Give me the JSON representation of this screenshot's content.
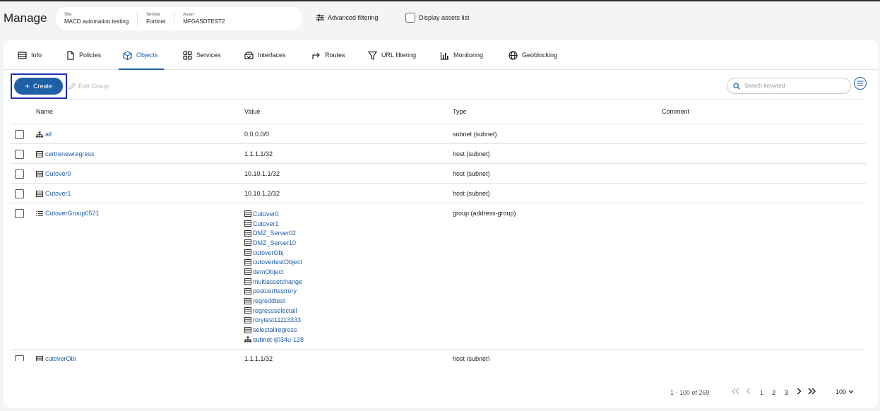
{
  "header": {
    "title": "Manage",
    "context": [
      {
        "label": "Site",
        "value": "MACD automation testing"
      },
      {
        "label": "Service",
        "value": "Fortinet"
      },
      {
        "label": "Asset",
        "value": "MFGASDTEST2"
      }
    ],
    "advanced_filtering": "Advanced filtering",
    "display_assets": "Display assets list"
  },
  "tabs": [
    {
      "label": "Info",
      "icon": "info-list-icon"
    },
    {
      "label": "Policies",
      "icon": "document-icon"
    },
    {
      "label": "Objects",
      "icon": "cube-icon",
      "active": true
    },
    {
      "label": "Services",
      "icon": "grid-icon"
    },
    {
      "label": "Interfaces",
      "icon": "interface-icon"
    },
    {
      "label": "Routes",
      "icon": "route-arrow-icon"
    },
    {
      "label": "URL filtering",
      "icon": "funnel-icon"
    },
    {
      "label": "Monitoring",
      "icon": "bar-chart-icon"
    },
    {
      "label": "Geoblocking",
      "icon": "globe-icon"
    }
  ],
  "toolbar": {
    "create_label": "Create",
    "edit_group_label": "Edit Group",
    "search_placeholder": "Search keyword"
  },
  "table": {
    "columns": [
      "Name",
      "Value",
      "Type",
      "Comment"
    ],
    "rows": [
      {
        "name": "all",
        "icon": "network-icon",
        "value": "0.0.0.0/0",
        "type": "subnet (subnet)",
        "comment": ""
      },
      {
        "name": "certrenewregress",
        "icon": "server-icon",
        "value": "1.1.1.1/32",
        "type": "host (subnet)",
        "comment": ""
      },
      {
        "name": "Cutover0",
        "icon": "server-icon",
        "value": "10.10.1.1/32",
        "type": "host (subnet)",
        "comment": ""
      },
      {
        "name": "Cutover1",
        "icon": "server-icon",
        "value": "10.10.1.2/32",
        "type": "host (subnet)",
        "comment": ""
      },
      {
        "name": "CutoverGroup0521",
        "icon": "list-icon",
        "type": "group (address-group)",
        "comment": "",
        "members": [
          {
            "name": "Cutover0",
            "icon": "server-icon"
          },
          {
            "name": "Cutover1",
            "icon": "server-icon"
          },
          {
            "name": "DMZ_Server02",
            "icon": "server-icon"
          },
          {
            "name": "DMZ_Server10",
            "icon": "server-icon"
          },
          {
            "name": "cutoverObj",
            "icon": "server-icon"
          },
          {
            "name": "cutovertestObject",
            "icon": "server-icon"
          },
          {
            "name": "demObject",
            "icon": "server-icon"
          },
          {
            "name": "multiassetchange",
            "icon": "server-icon"
          },
          {
            "name": "postcerttestrory",
            "icon": "server-icon"
          },
          {
            "name": "regreddtest",
            "icon": "server-icon"
          },
          {
            "name": "regressselectall",
            "icon": "server-icon"
          },
          {
            "name": "rorytest11113333",
            "icon": "server-icon"
          },
          {
            "name": "selectallregress",
            "icon": "server-icon"
          },
          {
            "name": "subnet-lj034u-128",
            "icon": "network-icon"
          }
        ]
      },
      {
        "name": "cutoverObj",
        "icon": "server-icon",
        "value": "1.1.1.1/32",
        "type": "host (subnet)",
        "comment": ""
      }
    ]
  },
  "pagination": {
    "range_text": "1 - 100 of 269",
    "pages": [
      "1",
      "2",
      "3"
    ],
    "current_page": "1",
    "per_page": "100"
  },
  "colors": {
    "accent": "#1f5fa8",
    "highlight_border": "#2030b8"
  }
}
